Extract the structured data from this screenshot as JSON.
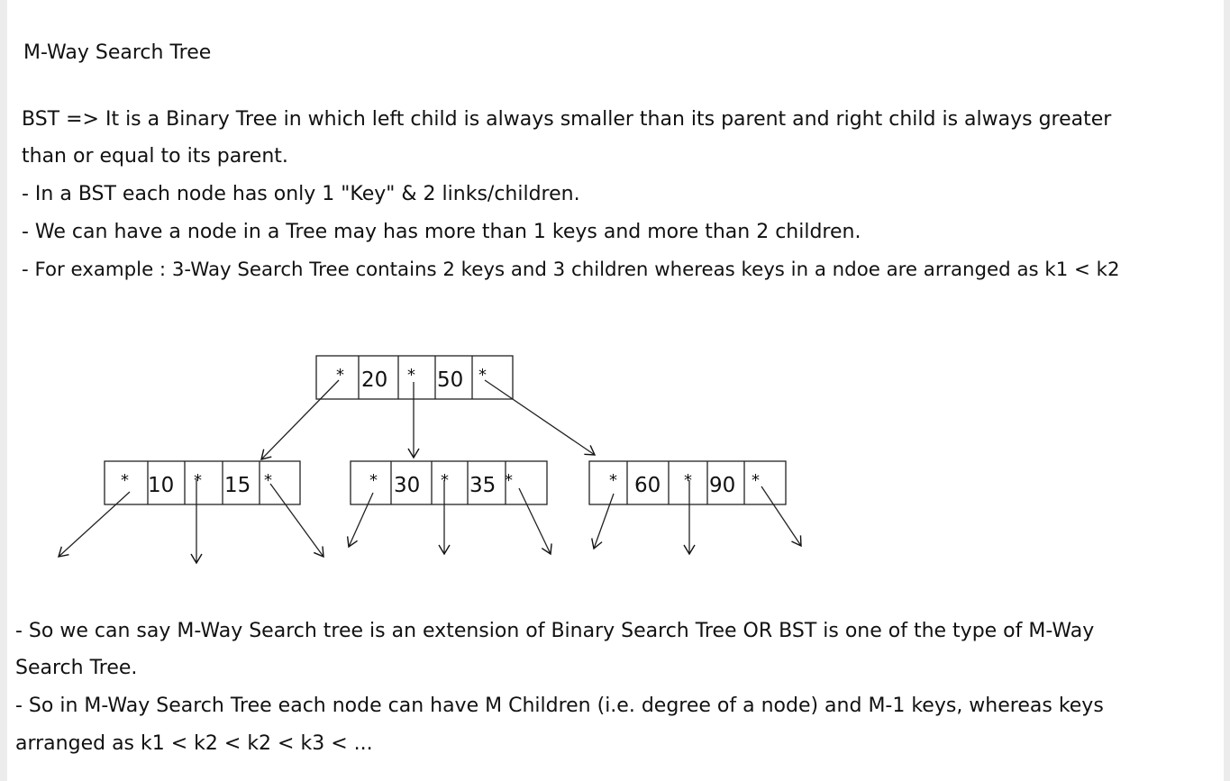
{
  "title": "M-Way Search Tree",
  "intro_lines": [
    "BST => It is a Binary Tree in which left child is always smaller than its parent and right child is always greater",
    "than or equal to its parent.",
    "- In a BST each node has only 1 \"Key\" & 2 links/children.",
    "- We can have a node in a Tree may has more than 1 keys and more than 2 children.",
    "- For example : 3-Way Search Tree contains 2 keys and 3 children whereas keys in a ndoe are arranged as  k1 < k2"
  ],
  "diagram": {
    "pointer_symbol": "*",
    "root": {
      "keys": [
        "20",
        "50"
      ]
    },
    "children": [
      {
        "keys": [
          "10",
          "15"
        ]
      },
      {
        "keys": [
          "30",
          "35"
        ]
      },
      {
        "keys": [
          "60",
          "90"
        ]
      }
    ]
  },
  "outro_lines": [
    "- So we can say M-Way Search tree is an extension of Binary Search Tree OR BST is one of the type of M-Way",
    "Search Tree.",
    "- So in M-Way Search Tree each node can have M Children (i.e. degree of a node) and M-1 keys, whereas keys",
    "arranged as k1 < k2 < k2 < k3 < ..."
  ]
}
